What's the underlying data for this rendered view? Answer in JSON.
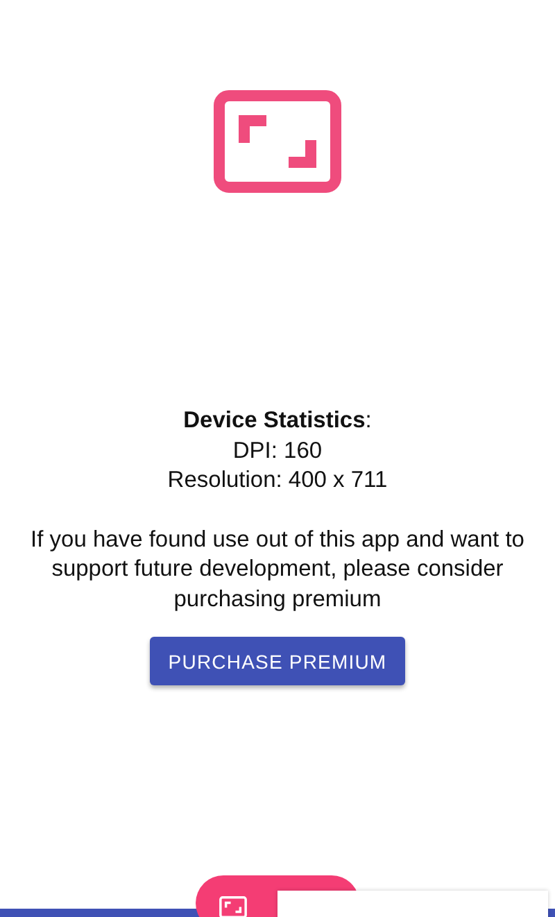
{
  "stats": {
    "heading": "**Device Statistics**:",
    "lines": [
      "DPI: 160",
      "Resolution: 400 x 711"
    ]
  },
  "message": "If you have found use out of this app and want to support future development, please consider purchasing premium",
  "purchase_button": "PURCHASE PREMIUM"
}
